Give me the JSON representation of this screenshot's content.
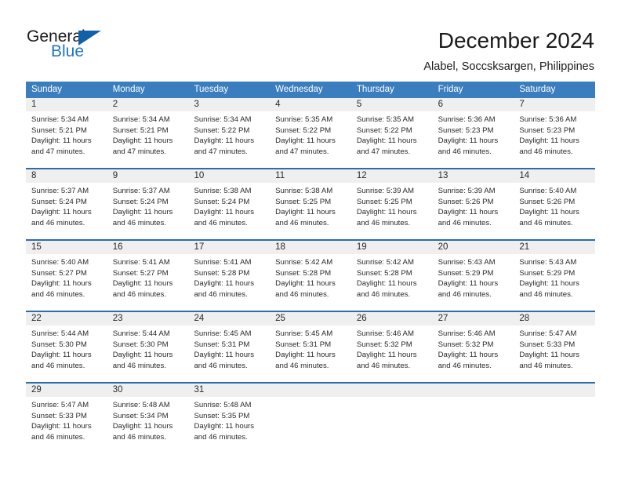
{
  "logo": {
    "primary_text": "General",
    "secondary_text": "Blue",
    "primary_color": "#1a1a1a",
    "secondary_color": "#1f76c2",
    "triangle_color": "#1161a8"
  },
  "header": {
    "title": "December 2024",
    "subtitle": "Alabel, Soccsksargen, Philippines"
  },
  "theme": {
    "header_bg": "#3a7ec0",
    "header_text": "#ffffff",
    "row_divider": "#2b6cad",
    "daynum_band": "#efefef",
    "cell_bg": "#ffffff",
    "text": "#2a2a2a"
  },
  "weekday_headers": [
    "Sunday",
    "Monday",
    "Tuesday",
    "Wednesday",
    "Thursday",
    "Friday",
    "Saturday"
  ],
  "weeks": [
    [
      {
        "day": "1",
        "sunrise": "Sunrise: 5:34 AM",
        "sunset": "Sunset: 5:21 PM",
        "daylight_1": "Daylight: 11 hours",
        "daylight_2": "and 47 minutes."
      },
      {
        "day": "2",
        "sunrise": "Sunrise: 5:34 AM",
        "sunset": "Sunset: 5:21 PM",
        "daylight_1": "Daylight: 11 hours",
        "daylight_2": "and 47 minutes."
      },
      {
        "day": "3",
        "sunrise": "Sunrise: 5:34 AM",
        "sunset": "Sunset: 5:22 PM",
        "daylight_1": "Daylight: 11 hours",
        "daylight_2": "and 47 minutes."
      },
      {
        "day": "4",
        "sunrise": "Sunrise: 5:35 AM",
        "sunset": "Sunset: 5:22 PM",
        "daylight_1": "Daylight: 11 hours",
        "daylight_2": "and 47 minutes."
      },
      {
        "day": "5",
        "sunrise": "Sunrise: 5:35 AM",
        "sunset": "Sunset: 5:22 PM",
        "daylight_1": "Daylight: 11 hours",
        "daylight_2": "and 47 minutes."
      },
      {
        "day": "6",
        "sunrise": "Sunrise: 5:36 AM",
        "sunset": "Sunset: 5:23 PM",
        "daylight_1": "Daylight: 11 hours",
        "daylight_2": "and 46 minutes."
      },
      {
        "day": "7",
        "sunrise": "Sunrise: 5:36 AM",
        "sunset": "Sunset: 5:23 PM",
        "daylight_1": "Daylight: 11 hours",
        "daylight_2": "and 46 minutes."
      }
    ],
    [
      {
        "day": "8",
        "sunrise": "Sunrise: 5:37 AM",
        "sunset": "Sunset: 5:24 PM",
        "daylight_1": "Daylight: 11 hours",
        "daylight_2": "and 46 minutes."
      },
      {
        "day": "9",
        "sunrise": "Sunrise: 5:37 AM",
        "sunset": "Sunset: 5:24 PM",
        "daylight_1": "Daylight: 11 hours",
        "daylight_2": "and 46 minutes."
      },
      {
        "day": "10",
        "sunrise": "Sunrise: 5:38 AM",
        "sunset": "Sunset: 5:24 PM",
        "daylight_1": "Daylight: 11 hours",
        "daylight_2": "and 46 minutes."
      },
      {
        "day": "11",
        "sunrise": "Sunrise: 5:38 AM",
        "sunset": "Sunset: 5:25 PM",
        "daylight_1": "Daylight: 11 hours",
        "daylight_2": "and 46 minutes."
      },
      {
        "day": "12",
        "sunrise": "Sunrise: 5:39 AM",
        "sunset": "Sunset: 5:25 PM",
        "daylight_1": "Daylight: 11 hours",
        "daylight_2": "and 46 minutes."
      },
      {
        "day": "13",
        "sunrise": "Sunrise: 5:39 AM",
        "sunset": "Sunset: 5:26 PM",
        "daylight_1": "Daylight: 11 hours",
        "daylight_2": "and 46 minutes."
      },
      {
        "day": "14",
        "sunrise": "Sunrise: 5:40 AM",
        "sunset": "Sunset: 5:26 PM",
        "daylight_1": "Daylight: 11 hours",
        "daylight_2": "and 46 minutes."
      }
    ],
    [
      {
        "day": "15",
        "sunrise": "Sunrise: 5:40 AM",
        "sunset": "Sunset: 5:27 PM",
        "daylight_1": "Daylight: 11 hours",
        "daylight_2": "and 46 minutes."
      },
      {
        "day": "16",
        "sunrise": "Sunrise: 5:41 AM",
        "sunset": "Sunset: 5:27 PM",
        "daylight_1": "Daylight: 11 hours",
        "daylight_2": "and 46 minutes."
      },
      {
        "day": "17",
        "sunrise": "Sunrise: 5:41 AM",
        "sunset": "Sunset: 5:28 PM",
        "daylight_1": "Daylight: 11 hours",
        "daylight_2": "and 46 minutes."
      },
      {
        "day": "18",
        "sunrise": "Sunrise: 5:42 AM",
        "sunset": "Sunset: 5:28 PM",
        "daylight_1": "Daylight: 11 hours",
        "daylight_2": "and 46 minutes."
      },
      {
        "day": "19",
        "sunrise": "Sunrise: 5:42 AM",
        "sunset": "Sunset: 5:28 PM",
        "daylight_1": "Daylight: 11 hours",
        "daylight_2": "and 46 minutes."
      },
      {
        "day": "20",
        "sunrise": "Sunrise: 5:43 AM",
        "sunset": "Sunset: 5:29 PM",
        "daylight_1": "Daylight: 11 hours",
        "daylight_2": "and 46 minutes."
      },
      {
        "day": "21",
        "sunrise": "Sunrise: 5:43 AM",
        "sunset": "Sunset: 5:29 PM",
        "daylight_1": "Daylight: 11 hours",
        "daylight_2": "and 46 minutes."
      }
    ],
    [
      {
        "day": "22",
        "sunrise": "Sunrise: 5:44 AM",
        "sunset": "Sunset: 5:30 PM",
        "daylight_1": "Daylight: 11 hours",
        "daylight_2": "and 46 minutes."
      },
      {
        "day": "23",
        "sunrise": "Sunrise: 5:44 AM",
        "sunset": "Sunset: 5:30 PM",
        "daylight_1": "Daylight: 11 hours",
        "daylight_2": "and 46 minutes."
      },
      {
        "day": "24",
        "sunrise": "Sunrise: 5:45 AM",
        "sunset": "Sunset: 5:31 PM",
        "daylight_1": "Daylight: 11 hours",
        "daylight_2": "and 46 minutes."
      },
      {
        "day": "25",
        "sunrise": "Sunrise: 5:45 AM",
        "sunset": "Sunset: 5:31 PM",
        "daylight_1": "Daylight: 11 hours",
        "daylight_2": "and 46 minutes."
      },
      {
        "day": "26",
        "sunrise": "Sunrise: 5:46 AM",
        "sunset": "Sunset: 5:32 PM",
        "daylight_1": "Daylight: 11 hours",
        "daylight_2": "and 46 minutes."
      },
      {
        "day": "27",
        "sunrise": "Sunrise: 5:46 AM",
        "sunset": "Sunset: 5:32 PM",
        "daylight_1": "Daylight: 11 hours",
        "daylight_2": "and 46 minutes."
      },
      {
        "day": "28",
        "sunrise": "Sunrise: 5:47 AM",
        "sunset": "Sunset: 5:33 PM",
        "daylight_1": "Daylight: 11 hours",
        "daylight_2": "and 46 minutes."
      }
    ],
    [
      {
        "day": "29",
        "sunrise": "Sunrise: 5:47 AM",
        "sunset": "Sunset: 5:33 PM",
        "daylight_1": "Daylight: 11 hours",
        "daylight_2": "and 46 minutes."
      },
      {
        "day": "30",
        "sunrise": "Sunrise: 5:48 AM",
        "sunset": "Sunset: 5:34 PM",
        "daylight_1": "Daylight: 11 hours",
        "daylight_2": "and 46 minutes."
      },
      {
        "day": "31",
        "sunrise": "Sunrise: 5:48 AM",
        "sunset": "Sunset: 5:35 PM",
        "daylight_1": "Daylight: 11 hours",
        "daylight_2": "and 46 minutes."
      },
      {
        "day": "",
        "sunrise": "",
        "sunset": "",
        "daylight_1": "",
        "daylight_2": ""
      },
      {
        "day": "",
        "sunrise": "",
        "sunset": "",
        "daylight_1": "",
        "daylight_2": ""
      },
      {
        "day": "",
        "sunrise": "",
        "sunset": "",
        "daylight_1": "",
        "daylight_2": ""
      },
      {
        "day": "",
        "sunrise": "",
        "sunset": "",
        "daylight_1": "",
        "daylight_2": ""
      }
    ]
  ]
}
